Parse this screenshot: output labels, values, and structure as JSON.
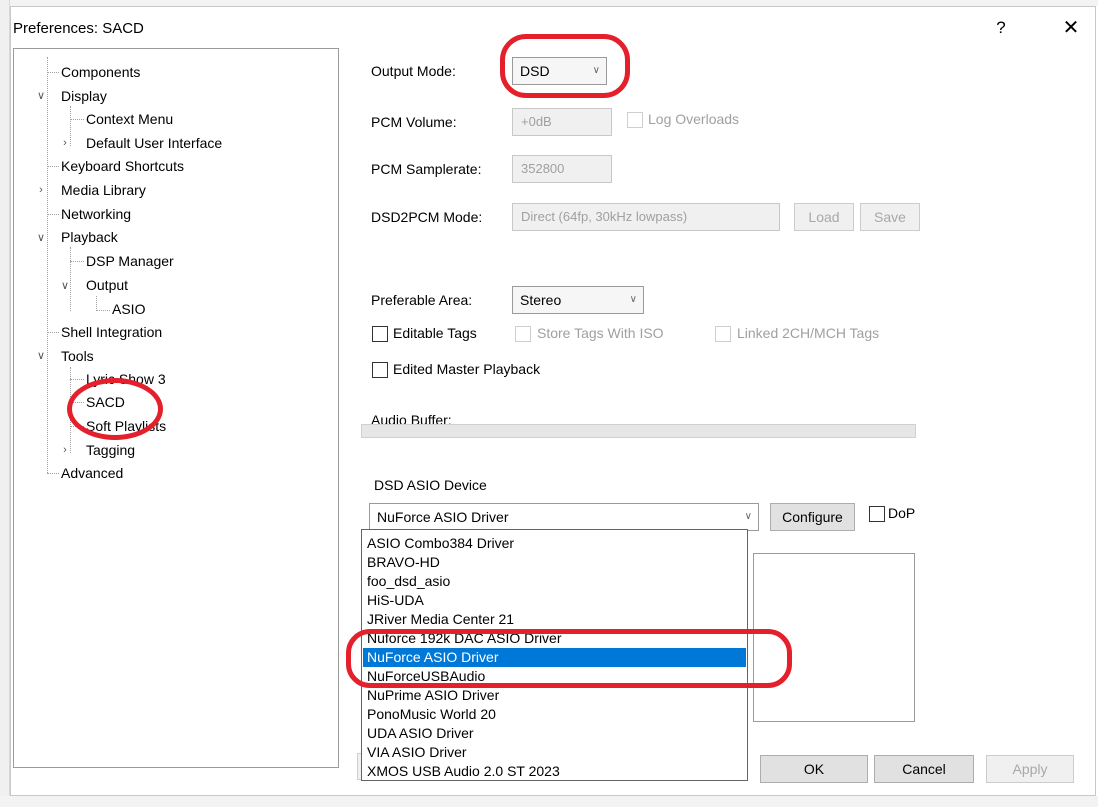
{
  "window": {
    "title": "Preferences: SACD",
    "help_label": "?",
    "close_label": "✕"
  },
  "tree": {
    "items": [
      {
        "label": "Components"
      },
      {
        "label": "Display"
      },
      {
        "label": "Context Menu"
      },
      {
        "label": "Default User Interface"
      },
      {
        "label": "Keyboard Shortcuts"
      },
      {
        "label": "Media Library"
      },
      {
        "label": "Networking"
      },
      {
        "label": "Playback"
      },
      {
        "label": "DSP Manager"
      },
      {
        "label": "Output"
      },
      {
        "label": "ASIO"
      },
      {
        "label": "Shell Integration"
      },
      {
        "label": "Tools"
      },
      {
        "label": "Lyric Show 3"
      },
      {
        "label": "SACD"
      },
      {
        "label": "Soft Playlists"
      },
      {
        "label": "Tagging"
      },
      {
        "label": "Advanced"
      }
    ]
  },
  "settings": {
    "output_mode_label": "Output Mode:",
    "output_mode_value": "DSD",
    "pcm_volume_label": "PCM Volume:",
    "pcm_volume_value": "+0dB",
    "log_overloads_label": "Log Overloads",
    "pcm_samplerate_label": "PCM Samplerate:",
    "pcm_samplerate_value": "352800",
    "dsd2pcm_label": "DSD2PCM Mode:",
    "dsd2pcm_value": "Direct (64fp, 30kHz lowpass)",
    "load_label": "Load",
    "save_label": "Save",
    "preferable_area_label": "Preferable Area:",
    "preferable_area_value": "Stereo",
    "editable_tags_label": "Editable Tags",
    "store_tags_label": "Store Tags With ISO",
    "linked_tags_label": "Linked 2CH/MCH Tags",
    "edited_master_label": "Edited Master Playback",
    "audio_buffer_label": "Audio Buffer:",
    "dsd_asio_label": "DSD ASIO Device",
    "asio_device_value": "NuForce ASIO Driver",
    "configure_label": "Configure",
    "dop_label": "DoP"
  },
  "dropdown": {
    "options": [
      "ASIO Combo384 Driver",
      "BRAVO-HD",
      "foo_dsd_asio",
      "HiS-UDA",
      "JRiver Media Center 21",
      "Nuforce 192k DAC ASIO Driver",
      "NuForce ASIO Driver",
      "NuForceUSBAudio",
      "NuPrime ASIO Driver",
      "PonoMusic World 20",
      "UDA ASIO Driver",
      "VIA ASIO Driver",
      "XMOS USB Audio 2.0 ST 2023"
    ],
    "selected_index": 6
  },
  "footer": {
    "ok_label": "OK",
    "cancel_label": "Cancel",
    "apply_label": "Apply"
  },
  "colors": {
    "annotation": "#e4202c",
    "selection": "#0078d7"
  }
}
